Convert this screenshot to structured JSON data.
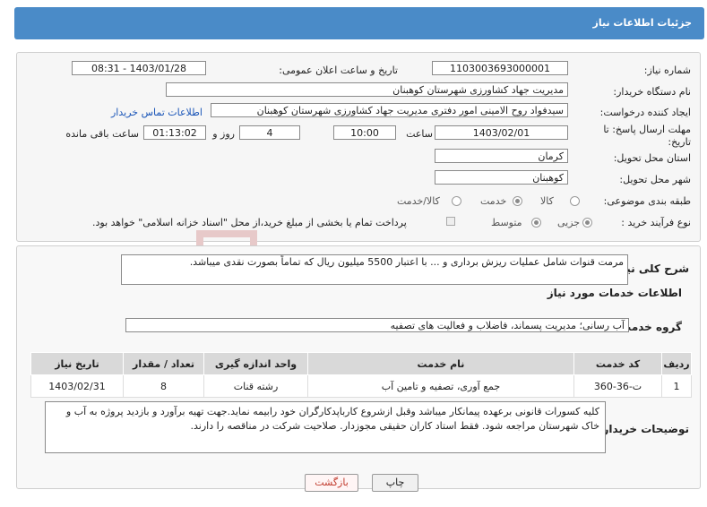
{
  "header": {
    "title": "جزئیات اطلاعات نیاز"
  },
  "info": {
    "need_number_label": "شماره نیاز:",
    "need_number": "1103003693000001",
    "announce_label": "تاریخ و ساعت اعلان عمومی:",
    "announce_value": "1403/01/28 - 08:31",
    "buyer_org_label": "نام دستگاه خریدار:",
    "buyer_org": "مدیریت جهاد کشاورزی شهرستان کوهبنان",
    "creator_label": "ایجاد کننده درخواست:",
    "creator": "سیدفواد روح الامینی امور دفتری مدیریت جهاد کشاورزی شهرستان کوهبنان",
    "contact_link": "اطلاعات تماس خریدار",
    "deadline_label_1": "مهلت ارسال پاسخ: تا",
    "deadline_label_2": "تاریخ:",
    "deadline_date": "1403/02/01",
    "time_label": "ساعت",
    "deadline_time": "10:00",
    "days": "4",
    "days_label": "روز و",
    "remaining_time": "01:13:02",
    "remaining_label": "ساعت باقی مانده",
    "province_label": "استان محل تحویل:",
    "province": "کرمان",
    "city_label": "شهر محل تحویل:",
    "city": "کوهبنان",
    "category_label": "طبقه بندی موضوعی:",
    "category_options": [
      "کالا",
      "خدمت",
      "کالا/خدمت"
    ],
    "category_selected": "خدمت",
    "process_label": "نوع فرآیند خرید :",
    "process_options": [
      "جزیی",
      "متوسط"
    ],
    "process_selected": "جزیی",
    "payment_note": "پرداخت تمام یا بخشی از مبلغ خرید،از محل \"اسناد خزانه اسلامی\" خواهد بود."
  },
  "summary": {
    "label": "شرح کلی نیاز:",
    "text": "مرمت قنوات شامل عملیات ریزش برداری و ... با اعتبار 5500 میلیون ریال که تماماً بصورت نقدی میباشد."
  },
  "services": {
    "title": "اطلاعات خدمات مورد نیاز",
    "group_label": "گروه خدمت:",
    "group_value": "آب رسانی؛ مدیریت پسماند، فاضلاب و فعالیت های تصفیه",
    "table": {
      "headers": [
        "ردیف",
        "کد خدمت",
        "نام خدمت",
        "واحد اندازه گیری",
        "تعداد / مقدار",
        "تاریخ نیاز"
      ],
      "rows": [
        [
          "1",
          "ت-36-360",
          "جمع آوری، تصفیه و تامین آب",
          "رشته قنات",
          "8",
          "1403/02/31"
        ]
      ]
    }
  },
  "notes": {
    "label": "توضیحات خریدار:",
    "text": "کلیه کسورات قانونی برعهده پیمانکار میباشد وقبل ازشروع کارباپدکارگران خود رابیمه نماید.جهت تهیه برآورد و بازدید پروژه به آب و خاک شهرستان مراجعه شود. فقط استاد کاران حقیقی مجوزدار. صلاحیت شرکت در مناقصه را دارند."
  },
  "buttons": {
    "print": "چاپ",
    "back": "بازگشت"
  },
  "watermark": {
    "text": "AriaTender.neT"
  },
  "colors": {
    "header": "#4a8bc8",
    "link": "#1a55b8",
    "watermark": "#e7c9c9"
  }
}
